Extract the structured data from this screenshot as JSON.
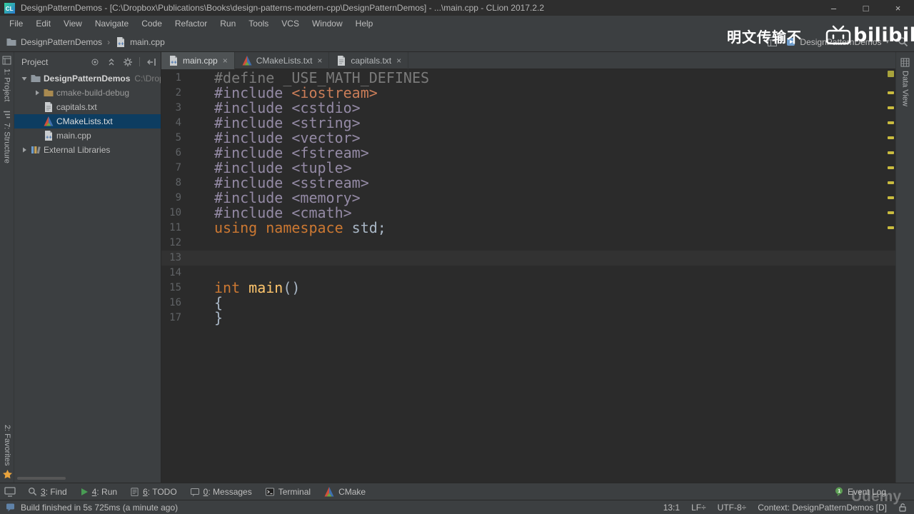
{
  "colors": {
    "panel": "#3c3f41",
    "editor": "#2b2b2b",
    "titlebar": "#2e2e2e",
    "border": "#282828",
    "selection": "#0d3d61",
    "caretline": "#323232",
    "text": "#bbbbbb",
    "linenum": "#606366",
    "kw": "#cc7832",
    "fn": "#ffc66d",
    "pl": "#a9b7c6",
    "dim": "#7a7a7a",
    "dir": "#948aa5",
    "inc": "#cb7d58",
    "warn": "#c9bb3e",
    "tab_active": "#4e5254"
  },
  "title_bar": {
    "title": "DesignPatternDemos - [C:\\Dropbox\\Publications\\Books\\design-patterns-modern-cpp\\DesignPatternDemos] - ...\\main.cpp - CLion 2017.2.2",
    "controls": [
      {
        "name": "minimize",
        "glyph": "–"
      },
      {
        "name": "maximize",
        "glyph": "□"
      },
      {
        "name": "close",
        "glyph": "×"
      }
    ]
  },
  "menu_bar": {
    "items": [
      "File",
      "Edit",
      "View",
      "Navigate",
      "Code",
      "Refactor",
      "Run",
      "Tools",
      "VCS",
      "Window",
      "Help"
    ]
  },
  "nav_bar": {
    "breadcrumb": [
      {
        "label": "DesignPatternDemos",
        "icon": "folder"
      },
      {
        "label": "main.cpp",
        "icon": "file-cpp"
      }
    ],
    "separator": "›",
    "run_config": {
      "label": "DesignPatternDemos",
      "arrow": "▾"
    },
    "watermark_cn": "明文传输不",
    "watermark_logo": "bilibili"
  },
  "left_stripe": {
    "tabs": [
      {
        "label": "1: Project",
        "icon": "project-tool"
      },
      {
        "label": "7: Structure",
        "icon": "structure-tool"
      },
      {
        "label": "2: Favorites",
        "icon": "star",
        "icon_pos": "after"
      }
    ]
  },
  "project_panel": {
    "title": "Project",
    "toolbar_icons": [
      "locate",
      "collapse-all",
      "gear",
      "hide"
    ],
    "tree": [
      {
        "label": "DesignPatternDemos",
        "hint": "C:\\Drop",
        "icon": "folder",
        "chevron": "down",
        "indent": 0,
        "style": "bold",
        "selected": false
      },
      {
        "label": "cmake-build-debug",
        "icon": "folder-ex",
        "chevron": "right",
        "indent": 1,
        "style": "dim",
        "selected": false
      },
      {
        "label": "capitals.txt",
        "icon": "file-text",
        "indent": 1,
        "selected": false
      },
      {
        "label": "CMakeLists.txt",
        "icon": "file-cmake",
        "indent": 1,
        "selected": true
      },
      {
        "label": "main.cpp",
        "icon": "file-cpp",
        "indent": 1,
        "selected": false
      },
      {
        "label": "External Libraries",
        "icon": "lib",
        "chevron": "right",
        "indent": 0,
        "selected": false
      }
    ]
  },
  "editor": {
    "tabs": [
      {
        "label": "main.cpp",
        "icon": "file-cpp",
        "active": true
      },
      {
        "label": "CMakeLists.txt",
        "icon": "file-cmake",
        "active": false
      },
      {
        "label": "capitals.txt",
        "icon": "file-text",
        "active": false
      }
    ],
    "close_glyph": "×",
    "caret_line": 13,
    "warning_lines": [
      2,
      3,
      4,
      5,
      6,
      7,
      8,
      9,
      10,
      11
    ],
    "code_lines": [
      [
        {
          "t": "#define _USE_MATH_DEFINES",
          "c": "dim"
        }
      ],
      [
        {
          "t": "#include ",
          "c": "dir"
        },
        {
          "t": "<iostream>",
          "c": "inc"
        }
      ],
      [
        {
          "t": "#include ",
          "c": "dir"
        },
        {
          "t": "<cstdio>",
          "c": "dir"
        }
      ],
      [
        {
          "t": "#include ",
          "c": "dir"
        },
        {
          "t": "<string>",
          "c": "dir"
        }
      ],
      [
        {
          "t": "#include ",
          "c": "dir"
        },
        {
          "t": "<vector>",
          "c": "dir"
        }
      ],
      [
        {
          "t": "#include ",
          "c": "dir"
        },
        {
          "t": "<fstream>",
          "c": "dir"
        }
      ],
      [
        {
          "t": "#include ",
          "c": "dir"
        },
        {
          "t": "<tuple>",
          "c": "dir"
        }
      ],
      [
        {
          "t": "#include ",
          "c": "dir"
        },
        {
          "t": "<sstream>",
          "c": "dir"
        }
      ],
      [
        {
          "t": "#include ",
          "c": "dir"
        },
        {
          "t": "<memory>",
          "c": "dir"
        }
      ],
      [
        {
          "t": "#include ",
          "c": "dir"
        },
        {
          "t": "<cmath>",
          "c": "dir"
        }
      ],
      [
        {
          "t": "using namespace",
          "c": "kw"
        },
        {
          "t": " std;",
          "c": "pl"
        }
      ],
      [],
      [],
      [],
      [
        {
          "t": "int",
          "c": "kw"
        },
        {
          "t": " ",
          "c": "pl"
        },
        {
          "t": "main",
          "c": "fn"
        },
        {
          "t": "()",
          "c": "pl"
        }
      ],
      [
        {
          "t": "{",
          "c": "pl"
        }
      ],
      [
        {
          "t": "}",
          "c": "pl"
        }
      ]
    ]
  },
  "right_stripe": {
    "tabs": [
      {
        "label": "Data View"
      }
    ]
  },
  "bottom_bar": {
    "left_buttons": [
      {
        "label": "3: Find",
        "icon": "find"
      },
      {
        "label": "4: Run",
        "icon": "run"
      },
      {
        "label": "6: TODO",
        "icon": "todo"
      },
      {
        "label": "0: Messages",
        "icon": "messages"
      },
      {
        "label": "Terminal",
        "icon": "terminal"
      },
      {
        "label": "CMake",
        "icon": "cmake"
      }
    ],
    "right_buttons": [
      {
        "label": "Event Log",
        "icon": "event"
      }
    ],
    "watermark": "Udemy"
  },
  "status_bar": {
    "message": "Build finished in 5s 725ms (a minute ago)",
    "position": "13:1",
    "line_sep": "LF÷",
    "encoding": "UTF-8÷",
    "context": "Context: DesignPatternDemos [D]"
  }
}
